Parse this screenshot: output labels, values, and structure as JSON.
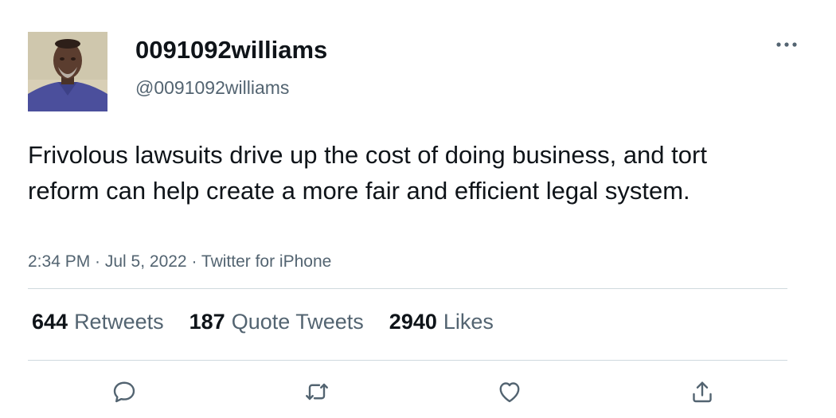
{
  "author": {
    "display_name": "0091092williams",
    "handle": "@0091092williams"
  },
  "tweet": {
    "text": "Frivolous lawsuits drive up the cost of doing business, and tort reform can help create a more fair and efficient legal system.",
    "meta": "2:34 PM · Jul 5, 2022 · Twitter for iPhone"
  },
  "stats": {
    "retweets_count": "644",
    "retweets_label": "Retweets",
    "quote_tweets_count": "187",
    "quote_tweets_label": "Quote Tweets",
    "likes_count": "2940",
    "likes_label": "Likes"
  },
  "icons": {
    "more": "more-horizontal-icon",
    "reply": "reply-icon",
    "retweet": "retweet-icon",
    "like": "heart-icon",
    "share": "share-icon"
  },
  "colors": {
    "text_primary": "#0f1419",
    "text_secondary": "#536471",
    "divider": "#cfd9de"
  }
}
